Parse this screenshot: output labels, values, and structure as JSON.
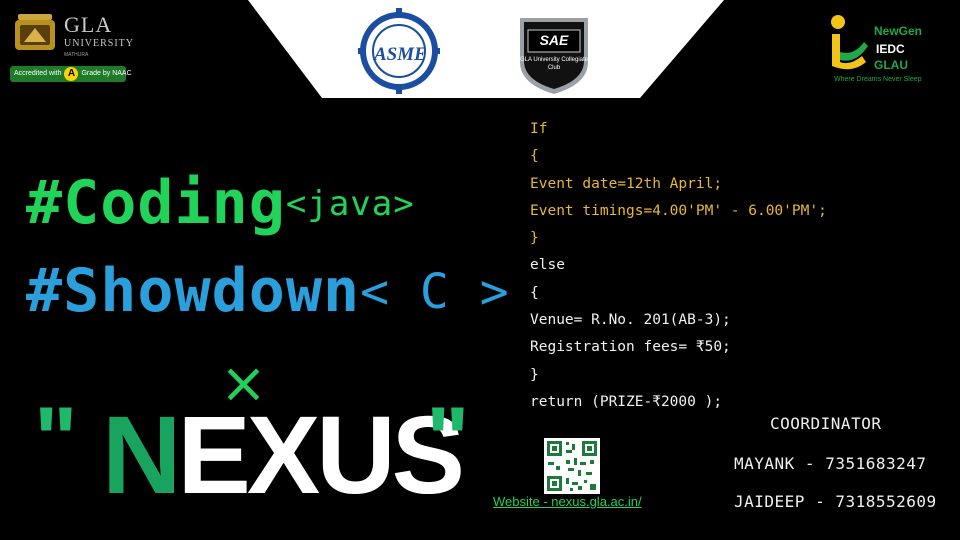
{
  "logos": {
    "gla": {
      "name": "GLA",
      "university": "UNIVERSITY",
      "city": "MATHURA",
      "accreditation_prefix": "Accredited with",
      "accreditation_grade": "A",
      "accreditation_suffix": "Grade by NAAC"
    },
    "asme": {
      "label": "ASME"
    },
    "sae": {
      "label": "SAE",
      "sub": "GLA University Collegiate Club"
    },
    "iedc": {
      "line1": "NewGen",
      "line2": "IEDC",
      "line3": "GLAU",
      "tagline": "Where Dreams Never Sleep"
    }
  },
  "title": {
    "line1_hash": "#Coding",
    "line1_lang": "<java>",
    "line2_hash": "#Showdown",
    "line2_lang": "< C >",
    "times": "×",
    "event_name": "NEXUS",
    "quote_open": "\"",
    "quote_close": "\""
  },
  "code": [
    {
      "text": "If",
      "color": "#e8b830"
    },
    {
      "text": "{",
      "color": "#e8b830"
    },
    {
      "text": "Event date=12th April;",
      "color": "#e8b830"
    },
    {
      "text": "Event timings=4.00'PM' - 6.00'PM';",
      "color": "#e8b830"
    },
    {
      "text": "}",
      "color": "#e8b830"
    },
    {
      "text": "else",
      "color": "#f1f1f1"
    },
    {
      "text": "{",
      "color": "#f1f1f1"
    },
    {
      "text": "Venue= R.No. 201(AB-3);",
      "color": "#f1f1f1"
    },
    {
      "text": "Registration fees= ₹50;",
      "color": "#f1f1f1"
    },
    {
      "text": "}",
      "color": "#f1f1f1"
    },
    {
      "text": "return (PRIZE-₹2000 );",
      "color": "#f1f1f1"
    }
  ],
  "website": "Website - nexus.gla.ac.in/",
  "coordinator": {
    "title": "COORDINATOR",
    "people": [
      "MAYANK - 7351683247",
      "JAIDEEP - 7318552609"
    ]
  },
  "colors": {
    "background": "#000000",
    "coding_green": "#22d35a",
    "showdown_blue": "#2a9fdc",
    "nexus_green": "#18a35e",
    "code_yellow": "#e8b830"
  }
}
